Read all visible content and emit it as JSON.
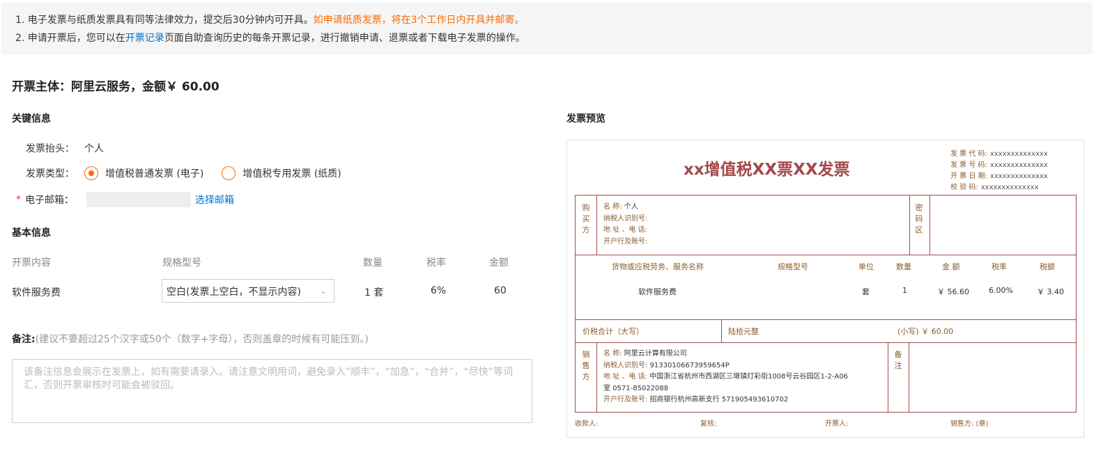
{
  "notice": {
    "line1_a": "1. 电子发票与纸质发票具有同等法律效力，提交后30分钟内可开具。",
    "line1_b": "如申请纸质发票，将在3个工作日内开具并邮寄。",
    "line2_a": "2. 申请开票后，您可以在",
    "line2_link": "开票记录",
    "line2_b": "页面自助查询历史的每条开票记录，进行撤销申请、退票或者下载电子发票的操作。"
  },
  "title": "开票主体：阿里云服务，金额￥ 60.00",
  "key_info": {
    "heading": "关键信息",
    "header_label": "发票抬头：",
    "header_value": "个人",
    "type_label": "发票类型：",
    "type_options": [
      "增值税普通发票 (电子)",
      "增值税专用发票 (纸质)"
    ],
    "type_selected": 0,
    "email_label": "电子邮箱：",
    "email_star": "*",
    "email_link": "选择邮箱"
  },
  "basic_info": {
    "heading": "基本信息",
    "columns": [
      "开票内容",
      "规格型号",
      "数量",
      "税率",
      "金额"
    ],
    "row": {
      "content": "软件服务费",
      "spec": "空白(发票上空白，不显示内容)",
      "qty": "1 套",
      "tax": "6%",
      "amount": "60"
    }
  },
  "remark": {
    "label": "备注:",
    "hint": "(建议不要超过25个汉字或50个（数字+字母），否则盖章的时候有可能压到。)",
    "placeholder": "该备注信息会展示在发票上，如有需要请录入。请注意文明用词，避免录入“顺丰”，“加急”，“合并”，“尽快”等词汇，否则开票审核时可能会被驳回。"
  },
  "preview": {
    "heading": "发票预览",
    "title": "xx增值税XX票XX发票",
    "meta": [
      {
        "label": "发 票 代 码:",
        "value": "xxxxxxxxxxxxxx"
      },
      {
        "label": "发 票 号 码:",
        "value": "xxxxxxxxxxxxxx"
      },
      {
        "label": "开 票 日 期:",
        "value": "xxxxxxxxxxxxxx"
      },
      {
        "label": "校  验  码:",
        "value": "xxxxxxxxxxxxxx"
      }
    ],
    "buyer_label": "购买方",
    "buyer": [
      {
        "label": "名         称:",
        "value": "个人"
      },
      {
        "label": "纳税人识别号:",
        "value": ""
      },
      {
        "label": "地 址 、电 话:",
        "value": ""
      },
      {
        "label": "开户行及账号:",
        "value": ""
      }
    ],
    "cipher_label": "密码区",
    "goods_headers": [
      "货物或应税劳务、服务名称",
      "规格型号",
      "单位",
      "数量",
      "金 额",
      "税率",
      "税额"
    ],
    "goods_row": [
      "软件服务费",
      "",
      "套",
      "1",
      "￥ 56.60",
      "6.00%",
      "￥ 3.40"
    ],
    "total_label": "价税合计（大写）",
    "total_big": "陆拾元整",
    "total_small": "(小写) ￥ 60.00",
    "seller_label": "销售方",
    "seller": [
      {
        "label": "名         称:",
        "value": "阿里云计算有限公司"
      },
      {
        "label": "纳税人识别号:",
        "value": "91330106673959654P"
      },
      {
        "label": "地 址 、电 话:",
        "value": "中国浙江省杭州市西湖区三墩镇灯彩街1008号云谷园区1-2-A06"
      },
      {
        "label": "",
        "value": "室 0571-85022088"
      },
      {
        "label": "开户行及账号:",
        "value": "招商银行杭州高新支行 571905493610702"
      }
    ],
    "remark_label": "备注",
    "signs": [
      "收款人:",
      "复核:",
      "开票人:",
      "销售方: (章)"
    ]
  }
}
